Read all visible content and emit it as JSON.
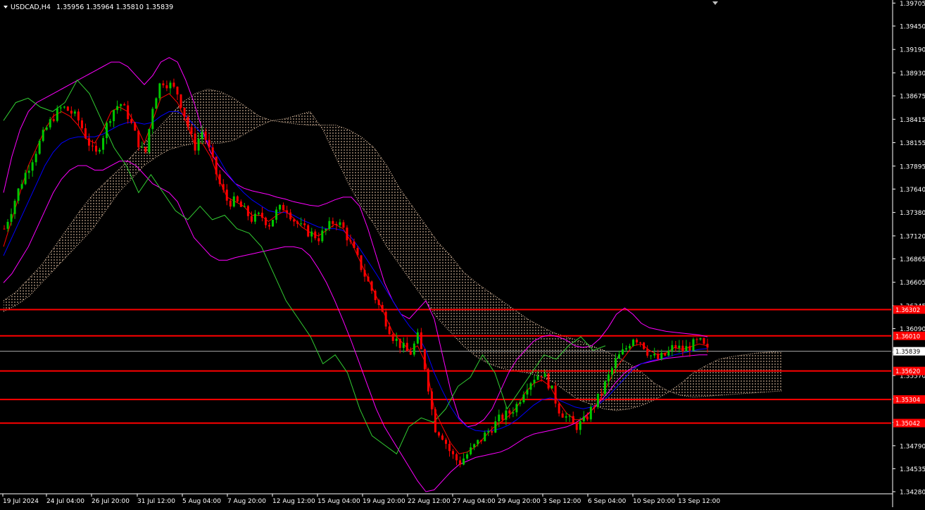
{
  "header": {
    "symbol": "USDCAD,H4",
    "ohlc": "1.35956 1.35964 1.35810 1.35839"
  },
  "colors": {
    "background": "#000000",
    "candle_up": "#00c800",
    "candle_down": "#ff0000",
    "tenkan": "#ff0000",
    "kijun": "#0000ff",
    "chikou": "#32cd32",
    "bollinger": "#ff00ff",
    "cloud": "#ffdab9",
    "level_line": "#ff0000",
    "axis": "#ffffff"
  },
  "chart_data": {
    "type": "candlestick",
    "title": "USDCAD,H4",
    "ylim": [
      1.3428,
      1.397
    ],
    "current_price": 1.35839,
    "y_ticks": [
      "1.39705",
      "1.39450",
      "1.39190",
      "1.38930",
      "1.38675",
      "1.38415",
      "1.38155",
      "1.37895",
      "1.37640",
      "1.37380",
      "1.37120",
      "1.36865",
      "1.36605",
      "1.36345",
      "1.36090",
      "1.35830",
      "1.35570",
      "1.35310",
      "1.35050",
      "1.34790",
      "1.34535",
      "1.34280"
    ],
    "x_ticks": [
      "19 Jul 2024",
      "24 Jul 04:00",
      "26 Jul 20:00",
      "31 Jul 12:00",
      "5 Aug 04:00",
      "7 Aug 20:00",
      "12 Aug 12:00",
      "15 Aug 04:00",
      "19 Aug 20:00",
      "22 Aug 12:00",
      "27 Aug 04:00",
      "29 Aug 20:00",
      "3 Sep 12:00",
      "6 Sep 04:00",
      "10 Sep 20:00",
      "13 Sep 12:00"
    ],
    "horizontal_levels": [
      {
        "value": 1.36302,
        "label": "1.36302"
      },
      {
        "value": 1.3601,
        "label": "1.36010"
      },
      {
        "value": 1.3562,
        "label": "1.35620"
      },
      {
        "value": 1.35304,
        "label": "1.35304"
      },
      {
        "value": 1.35042,
        "label": "1.35042"
      }
    ],
    "current_price_label": "1.35839",
    "close_path": [
      1.372,
      1.3745,
      1.377,
      1.379,
      1.381,
      1.383,
      1.3845,
      1.3855,
      1.385,
      1.384,
      1.382,
      1.38,
      1.3825,
      1.385,
      1.386,
      1.3845,
      1.382,
      1.38,
      1.386,
      1.3885,
      1.388,
      1.387,
      1.384,
      1.381,
      1.383,
      1.38,
      1.377,
      1.375,
      1.375,
      1.374,
      1.373,
      1.3735,
      1.3725,
      1.374,
      1.3745,
      1.373,
      1.372,
      1.3715,
      1.371,
      1.372,
      1.373,
      1.372,
      1.37,
      1.368,
      1.366,
      1.364,
      1.362,
      1.36,
      1.359,
      1.358,
      1.36,
      1.356,
      1.35,
      1.349,
      1.347,
      1.346,
      1.347,
      1.348,
      1.349,
      1.35,
      1.351,
      1.3515,
      1.3525,
      1.3545,
      1.3555,
      1.356,
      1.3545,
      1.352,
      1.351,
      1.35,
      1.3505,
      1.352,
      1.3535,
      1.3555,
      1.3575,
      1.3585,
      1.36,
      1.3595,
      1.358,
      1.3575,
      1.358,
      1.359,
      1.3585,
      1.359,
      1.3595,
      1.35839
    ],
    "series": [
      {
        "name": "Tenkan",
        "values": [
          1.37,
          1.373,
          1.376,
          1.379,
          1.381,
          1.383,
          1.3845,
          1.385,
          1.3845,
          1.3835,
          1.382,
          1.3815,
          1.383,
          1.385,
          1.3855,
          1.385,
          1.3835,
          1.3815,
          1.384,
          1.3865,
          1.387,
          1.386,
          1.384,
          1.3815,
          1.3815,
          1.38,
          1.3775,
          1.3755,
          1.375,
          1.3745,
          1.3735,
          1.3735,
          1.3728,
          1.3735,
          1.374,
          1.3732,
          1.3722,
          1.3716,
          1.3712,
          1.3718,
          1.3725,
          1.372,
          1.3705,
          1.3685,
          1.3665,
          1.3645,
          1.3625,
          1.3605,
          1.3595,
          1.3585,
          1.359,
          1.357,
          1.352,
          1.35,
          1.3482,
          1.347,
          1.3472,
          1.3478,
          1.3488,
          1.3498,
          1.3505,
          1.3512,
          1.3522,
          1.3538,
          1.3548,
          1.3552,
          1.3545,
          1.3528,
          1.3515,
          1.3508,
          1.3508,
          1.3518,
          1.353,
          1.3548,
          1.3566,
          1.3578,
          1.359,
          1.3592,
          1.3585,
          1.358,
          1.3582,
          1.3588,
          1.3586,
          1.3589,
          1.3592,
          1.359
        ]
      },
      {
        "name": "Kijun",
        "values": [
          1.369,
          1.371,
          1.373,
          1.375,
          1.377,
          1.379,
          1.3805,
          1.3815,
          1.382,
          1.3822,
          1.3822,
          1.3822,
          1.3825,
          1.383,
          1.3835,
          1.3838,
          1.3838,
          1.3836,
          1.3838,
          1.3845,
          1.385,
          1.385,
          1.3845,
          1.3835,
          1.3825,
          1.3812,
          1.3798,
          1.3782,
          1.377,
          1.376,
          1.3752,
          1.3746,
          1.374,
          1.3738,
          1.3738,
          1.3735,
          1.373,
          1.3726,
          1.3722,
          1.372,
          1.372,
          1.3718,
          1.371,
          1.3698,
          1.3684,
          1.367,
          1.3655,
          1.364,
          1.3625,
          1.3612,
          1.3602,
          1.3585,
          1.356,
          1.354,
          1.3522,
          1.3508,
          1.35,
          1.3496,
          1.3495,
          1.3496,
          1.3498,
          1.3502,
          1.3508,
          1.3516,
          1.3524,
          1.353,
          1.3532,
          1.353,
          1.3526,
          1.3522,
          1.352,
          1.3522,
          1.3526,
          1.3534,
          1.3544,
          1.3554,
          1.3564,
          1.357,
          1.3573,
          1.3575,
          1.3577,
          1.358,
          1.3582,
          1.3584,
          1.3586,
          1.3587
        ]
      },
      {
        "name": "Chikou",
        "values": [
          1.384,
          1.386,
          1.3865,
          1.3855,
          1.385,
          1.386,
          1.3885,
          1.387,
          1.384,
          1.381,
          1.379,
          1.376,
          1.378,
          1.376,
          1.374,
          1.373,
          1.3745,
          1.373,
          1.3735,
          1.372,
          1.3715,
          1.37,
          1.367,
          1.364,
          1.362,
          1.36,
          1.357,
          1.358,
          1.356,
          1.352,
          1.349,
          1.348,
          1.347,
          1.35,
          1.351,
          1.3505,
          1.352,
          1.3545,
          1.3555,
          1.358,
          1.356,
          1.352,
          1.354,
          1.356,
          1.358,
          1.3575,
          1.359,
          1.36,
          1.3585,
          1.359
        ]
      },
      {
        "name": "Bollinger Upper",
        "values": [
          1.376,
          1.38,
          1.383,
          1.385,
          1.386,
          1.3865,
          1.387,
          1.3875,
          1.388,
          1.3885,
          1.389,
          1.3895,
          1.39,
          1.3905,
          1.3905,
          1.39,
          1.389,
          1.388,
          1.389,
          1.3905,
          1.391,
          1.3905,
          1.3885,
          1.386,
          1.383,
          1.3805,
          1.379,
          1.378,
          1.377,
          1.3765,
          1.3762,
          1.376,
          1.3758,
          1.3755,
          1.3753,
          1.375,
          1.3748,
          1.3746,
          1.3745,
          1.3748,
          1.3752,
          1.3755,
          1.3755,
          1.3745,
          1.372,
          1.369,
          1.366,
          1.364,
          1.3625,
          1.362,
          1.363,
          1.364,
          1.362,
          1.358,
          1.354,
          1.351,
          1.35,
          1.3502,
          1.3508,
          1.352,
          1.354,
          1.356,
          1.3575,
          1.3585,
          1.3595,
          1.36,
          1.3602,
          1.36,
          1.3596,
          1.359,
          1.3588,
          1.359,
          1.3598,
          1.361,
          1.3625,
          1.3632,
          1.3625,
          1.3615,
          1.361,
          1.3608,
          1.3606,
          1.3605,
          1.3604,
          1.3603,
          1.3602,
          1.36
        ]
      },
      {
        "name": "Bollinger Lower",
        "values": [
          1.366,
          1.367,
          1.3685,
          1.37,
          1.372,
          1.374,
          1.376,
          1.3775,
          1.3785,
          1.379,
          1.379,
          1.3785,
          1.3785,
          1.379,
          1.3795,
          1.3795,
          1.379,
          1.378,
          1.377,
          1.3765,
          1.376,
          1.375,
          1.373,
          1.371,
          1.37,
          1.369,
          1.3685,
          1.3685,
          1.3688,
          1.369,
          1.3692,
          1.3694,
          1.3696,
          1.3698,
          1.37,
          1.37,
          1.3698,
          1.369,
          1.3676,
          1.366,
          1.364,
          1.3618,
          1.3595,
          1.357,
          1.3545,
          1.352,
          1.35,
          1.3485,
          1.347,
          1.3455,
          1.344,
          1.3428,
          1.343,
          1.344,
          1.345,
          1.3458,
          1.3462,
          1.3466,
          1.3468,
          1.347,
          1.3472,
          1.3476,
          1.3482,
          1.3488,
          1.3492,
          1.3494,
          1.3496,
          1.3498,
          1.35,
          1.3504,
          1.351,
          1.3518,
          1.3528,
          1.3538,
          1.355,
          1.356,
          1.3566,
          1.357,
          1.3572,
          1.3574,
          1.3576,
          1.3577,
          1.3578,
          1.3579,
          1.358,
          1.358
        ]
      },
      {
        "name": "Senkou A",
        "values": [
          1.3628,
          1.3635,
          1.3645,
          1.366,
          1.3675,
          1.369,
          1.3705,
          1.372,
          1.374,
          1.376,
          1.3775,
          1.379,
          1.38,
          1.3808,
          1.3812,
          1.3815,
          1.3815,
          1.3815,
          1.3818,
          1.3826,
          1.3834,
          1.384,
          1.3842,
          1.3846,
          1.385,
          1.383,
          1.38,
          1.377,
          1.3745,
          1.3725,
          1.37,
          1.368,
          1.366,
          1.364,
          1.362,
          1.3605,
          1.359,
          1.3578,
          1.357,
          1.3565,
          1.3562,
          1.356,
          1.3556,
          1.355,
          1.354,
          1.353,
          1.3525,
          1.352,
          1.3518,
          1.352,
          1.3524,
          1.353,
          1.3538,
          1.3548,
          1.356,
          1.3568,
          1.3575,
          1.3578,
          1.358,
          1.3582,
          1.3583,
          1.3584
        ]
      },
      {
        "name": "Senkou B",
        "values": [
          1.364,
          1.365,
          1.3665,
          1.368,
          1.37,
          1.372,
          1.374,
          1.3758,
          1.3772,
          1.3785,
          1.38,
          1.3815,
          1.383,
          1.3845,
          1.386,
          1.387,
          1.3875,
          1.3872,
          1.3865,
          1.3855,
          1.3845,
          1.384,
          1.3838,
          1.3836,
          1.3835,
          1.3835,
          1.3835,
          1.383,
          1.3822,
          1.381,
          1.379,
          1.3765,
          1.3745,
          1.3725,
          1.3705,
          1.369,
          1.3672,
          1.366,
          1.365,
          1.364,
          1.363,
          1.362,
          1.3612,
          1.3605,
          1.36,
          1.3596,
          1.359,
          1.3585,
          1.3578,
          1.357,
          1.356,
          1.3548,
          1.354,
          1.3535,
          1.3533,
          1.3534,
          1.3535,
          1.3536,
          1.3537,
          1.3538,
          1.3539,
          1.354
        ]
      }
    ]
  }
}
